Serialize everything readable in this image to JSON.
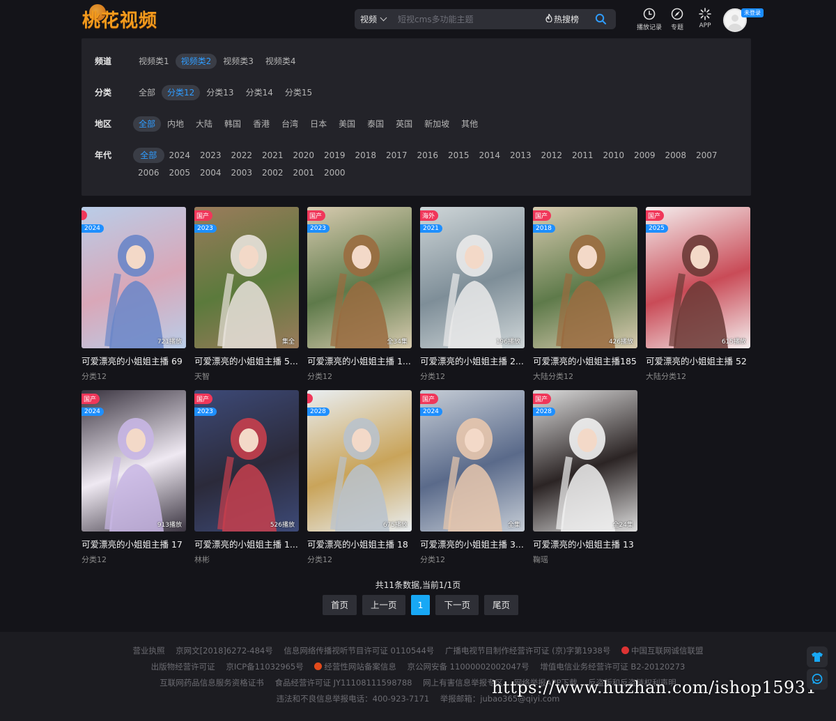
{
  "header": {
    "logo_text": "桃花视频",
    "search": {
      "category": "视频",
      "placeholder": "短视cms多功能主题",
      "hot_label": "热搜榜"
    },
    "nav": [
      {
        "label": "播放记录",
        "icon": "clock-icon"
      },
      {
        "label": "专题",
        "icon": "compass-icon"
      },
      {
        "label": "APP",
        "icon": "burst-icon"
      }
    ],
    "login_badge": "未登录"
  },
  "filters": [
    {
      "label": "频道",
      "options": [
        "视频类1",
        "视频类2",
        "视频类3",
        "视频类4"
      ],
      "active": 1
    },
    {
      "label": "分类",
      "options": [
        "全部",
        "分类12",
        "分类13",
        "分类14",
        "分类15"
      ],
      "active": 1
    },
    {
      "label": "地区",
      "options": [
        "全部",
        "内地",
        "大陆",
        "韩国",
        "香港",
        "台湾",
        "日本",
        "美国",
        "泰国",
        "英国",
        "新加坡",
        "其他"
      ],
      "active": 0
    },
    {
      "label": "年代",
      "options": [
        "全部",
        "2024",
        "2023",
        "2022",
        "2021",
        "2020",
        "2019",
        "2018",
        "2017",
        "2016",
        "2015",
        "2014",
        "2013",
        "2012",
        "2011",
        "2010",
        "2009",
        "2008",
        "2007",
        "2006",
        "2005",
        "2004",
        "2003",
        "2002",
        "2001",
        "2000"
      ],
      "active": 0
    }
  ],
  "videos": [
    {
      "title": "可爱漂亮的小姐姐主播 69",
      "sub": "分类12",
      "cat": "",
      "year": "2024",
      "note": "721播放",
      "palette": [
        "#b9cde8",
        "#6a86c8",
        "#d9a7b8"
      ]
    },
    {
      "title": "可爱漂亮的小姐姐主播 5...",
      "sub": "天智",
      "cat": "国产",
      "year": "2023",
      "note": "集全",
      "palette": [
        "#9b7b5c",
        "#e8e2dc",
        "#5b7a3c"
      ]
    },
    {
      "title": "可爱漂亮的小姐姐主播 1...",
      "sub": "分类12",
      "cat": "国产",
      "year": "2023",
      "note": "全34集",
      "palette": [
        "#d8cbb0",
        "#9a6b3f",
        "#5e7a4a"
      ]
    },
    {
      "title": "可爱漂亮的小姐姐主播 2...",
      "sub": "分类12",
      "cat": "海外",
      "year": "2021",
      "note": "196播放",
      "palette": [
        "#cfd6d8",
        "#eaeaea",
        "#7e8e98"
      ]
    },
    {
      "title": "可爱漂亮的小姐姐主播185",
      "sub": "大陆分类12",
      "cat": "国产",
      "year": "2018",
      "note": "426播放",
      "palette": [
        "#d8cbb0",
        "#9a6b3f",
        "#5e7a4a"
      ]
    },
    {
      "title": "可爱漂亮的小姐姐主播 52",
      "sub": "大陆分类12",
      "cat": "国产",
      "year": "2025",
      "note": "615播放",
      "palette": [
        "#f4eeee",
        "#6b3a36",
        "#c94b57"
      ]
    },
    {
      "title": "可爱漂亮的小姐姐主播 17",
      "sub": "分类12",
      "cat": "国产",
      "year": "2024",
      "note": "913播放",
      "palette": [
        "#3a3440",
        "#c8b6e4",
        "#efe9f2"
      ]
    },
    {
      "title": "可爱漂亮的小姐姐主播 1...",
      "sub": "林彬",
      "cat": "国产",
      "year": "2023",
      "note": "526播放",
      "palette": [
        "#3d4a78",
        "#c73f4d",
        "#2b2a3a"
      ]
    },
    {
      "title": "可爱漂亮的小姐姐主播 18",
      "sub": "分类12",
      "cat": "",
      "year": "2028",
      "note": "675播放",
      "palette": [
        "#e9eef2",
        "#b9c2cc",
        "#c9a45a"
      ]
    },
    {
      "title": "可爱漂亮的小姐姐主播 3...",
      "sub": "分类12",
      "cat": "国产",
      "year": "2024",
      "note": "全集",
      "palette": [
        "#c6cdd6",
        "#e8c7ad",
        "#5a6a8a"
      ]
    },
    {
      "title": "可爱漂亮的小姐姐主播 13",
      "sub": "鞠瑶",
      "cat": "国产",
      "year": "2028",
      "note": "全24集",
      "palette": [
        "#dcdcdc",
        "#f1f1f1",
        "#2b2424"
      ]
    }
  ],
  "pagination": {
    "info": "共11条数据,当前1/1页",
    "first": "首页",
    "prev": "上一页",
    "current": "1",
    "next": "下一页",
    "last": "尾页"
  },
  "footer": {
    "row1": [
      "营业执照",
      "京网文[2018]6272-484号",
      "信息网络传播视听节目许可证 0110544号",
      "广播电视节目制作经营许可证 (京)字第1938号",
      "中国互联网诚信联盟"
    ],
    "row2": [
      "出版物经营许可证",
      "京ICP备11032965号",
      "经营性网站备案信息",
      "京公网安备 11000002002047号",
      "增值电信业务经营许可证 B2-20120273"
    ],
    "row3": [
      "互联网药品信息服务资格证书",
      "食品经营许可证 JY11108111598788",
      "网上有害信息举报专区",
      "网络举报APP下载",
      "反盗版和反盗链权利声明"
    ],
    "row4": [
      "违法和不良信息举报电话：400-923-7171",
      "举报邮箱：jubao365@qiyi.com"
    ],
    "watermark": "https://www.huzhan.com/ishop15931"
  },
  "colors": {
    "accent": "#2f9cff",
    "tag_cat": "#f0375a",
    "tag_year": "#1e8fff",
    "page_current": "#18a8f5"
  }
}
